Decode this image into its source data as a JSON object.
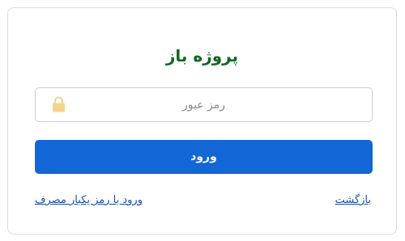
{
  "brand": {
    "name": "پروژه باز"
  },
  "password": {
    "placeholder": "رمز عبور",
    "value": ""
  },
  "login_button": {
    "label": "ورود"
  },
  "links": {
    "back": "بازگشت",
    "otp_login": "ورود با رمز یکبار مصرف"
  },
  "colors": {
    "brand": "#11681f",
    "primary": "#1366d6",
    "link": "#1a4fa8",
    "lock_icon": "#f3d48e"
  },
  "icons": {
    "password_field": "lock-icon",
    "brand_badge": "logo-badge-icon"
  }
}
